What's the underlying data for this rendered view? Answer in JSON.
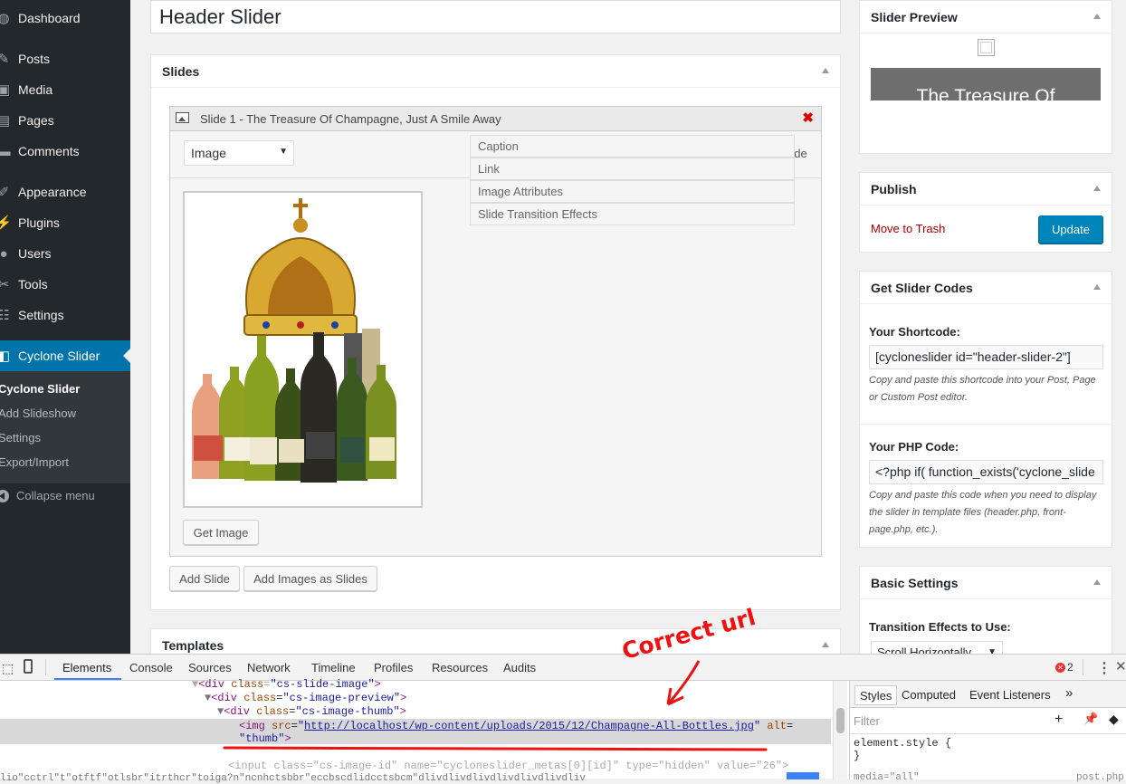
{
  "sidebar": {
    "items": [
      {
        "label": "Dashboard",
        "icon": "dashboard-icon"
      },
      {
        "label": "Posts",
        "icon": "pin-icon"
      },
      {
        "label": "Media",
        "icon": "media-icon"
      },
      {
        "label": "Pages",
        "icon": "pages-icon"
      },
      {
        "label": "Comments",
        "icon": "comments-icon"
      },
      {
        "label": "Appearance",
        "icon": "brush-icon"
      },
      {
        "label": "Plugins",
        "icon": "plugin-icon"
      },
      {
        "label": "Users",
        "icon": "users-icon"
      },
      {
        "label": "Tools",
        "icon": "wrench-icon"
      },
      {
        "label": "Settings",
        "icon": "settings-icon"
      },
      {
        "label": "Cyclone Slider",
        "icon": "slider-icon"
      }
    ],
    "submenu": [
      "Cyclone Slider",
      "Add Slideshow",
      "Settings",
      "Export/Import"
    ],
    "collapse_label": "Collapse menu"
  },
  "main": {
    "title": "Header Slider",
    "slides_box_title": "Slides",
    "slide_title": "Slide 1 - The Treasure Of Champagne, Just A Smile Away",
    "slide_type": "Image",
    "hide_label": "Hide",
    "accordions": [
      "Caption",
      "Link",
      "Image Attributes",
      "Slide Transition Effects"
    ],
    "get_image_label": "Get Image",
    "add_slide_label": "Add Slide",
    "add_images_label": "Add Images as Slides",
    "templates_title": "Templates"
  },
  "right": {
    "preview_title": "Slider Preview",
    "preview_text": "The Treasure Of",
    "publish_title": "Publish",
    "trash_label": "Move to Trash",
    "update_label": "Update",
    "codes_title": "Get Slider Codes",
    "shortcode_label": "Your Shortcode:",
    "shortcode_value": "[cycloneslider id=\"header-slider-2\"]",
    "shortcode_help_1": "Copy and paste this shortcode into your Post, Page",
    "shortcode_help_2": "or Custom Post editor.",
    "php_label": "Your PHP Code:",
    "php_value": "<?php if( function_exists('cyclone_slide",
    "php_help_1": "Copy and paste this code when you need to display",
    "php_help_2": "the slider in template files (header.php, front-",
    "php_help_3": "page.php, etc.).",
    "basic_title": "Basic Settings",
    "transition_label": "Transition Effects to Use:",
    "transition_value": "Scroll Horizontally"
  },
  "devtools": {
    "tabs": [
      "Elements",
      "Console",
      "Sources",
      "Network",
      "Timeline",
      "Profiles",
      "Resources",
      "Audits"
    ],
    "error_count": "2",
    "line1": {
      "tag": "div",
      "attr": "class",
      "val": "cs-slide-image"
    },
    "line2": {
      "tag": "div",
      "attr": "class",
      "val": "cs-image-preview"
    },
    "line3": {
      "tag": "div",
      "attr": "class",
      "val": "cs-image-thumb"
    },
    "img_src": "http://localhost/wp-content/uploads/2015/12/Champagne-All-Bottles.jpg",
    "img_alt": "thumb",
    "line5": "<input class=\"cs-image-id\" name=\"cycloneslider_metas[0][id]\" type=\"hidden\" value=\"26\">",
    "line6": "lio\"cctrl\"t\"otftf\"otlsbr\"itrthcr\"toiga?n\"ncnhctsbbr\"eccbscdlidcctsbcm\"dlivdlivdlivdlivdlivdlivdliv",
    "styles_tabs": [
      "Styles",
      "Computed",
      "Event Listeners"
    ],
    "filter_placeholder": "Filter",
    "element_style": "element.style {",
    "close_brace": "}",
    "media_text": "media=\"all\"",
    "post_text": "post.php"
  },
  "annotation": {
    "text": "Correct url",
    "color": "#ee1111"
  }
}
